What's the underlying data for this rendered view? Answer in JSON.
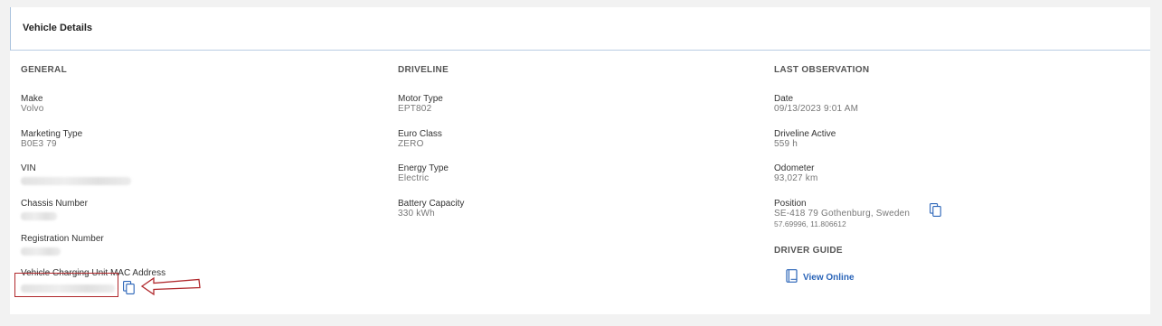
{
  "panel": {
    "title": "Vehicle Details"
  },
  "general": {
    "title": "GENERAL",
    "make_label": "Make",
    "make_value": "Volvo",
    "marketing_label": "Marketing Type",
    "marketing_value": "B0E3 79",
    "vin_label": "VIN",
    "chassis_label": "Chassis Number",
    "registration_label": "Registration Number",
    "mac_label": "Vehicle Charging Unit MAC Address"
  },
  "driveline": {
    "title": "DRIVELINE",
    "motor_label": "Motor Type",
    "motor_value": "EPT802",
    "euro_label": "Euro Class",
    "euro_value": "ZERO",
    "energy_label": "Energy Type",
    "energy_value": "Electric",
    "battery_label": "Battery Capacity",
    "battery_value": "330 kWh"
  },
  "last_observation": {
    "title": "LAST OBSERVATION",
    "date_label": "Date",
    "date_value": "09/13/2023 9:01 AM",
    "driveline_active_label": "Driveline Active",
    "driveline_active_value": "559 h",
    "odometer_label": "Odometer",
    "odometer_value": "93,027 km",
    "position_label": "Position",
    "position_value": "SE-418 79 Gothenburg, Sweden",
    "position_coords": "57.69996, 11.806612"
  },
  "driver_guide": {
    "title": "DRIVER GUIDE",
    "link_label": "View Online"
  },
  "icons": {
    "copy": "copy-icon",
    "book": "book-icon",
    "arrow": "annotation-arrow"
  },
  "colors": {
    "accent": "#2a64b8",
    "annotation": "#b0282c",
    "header_border": "#a9c2dd"
  }
}
